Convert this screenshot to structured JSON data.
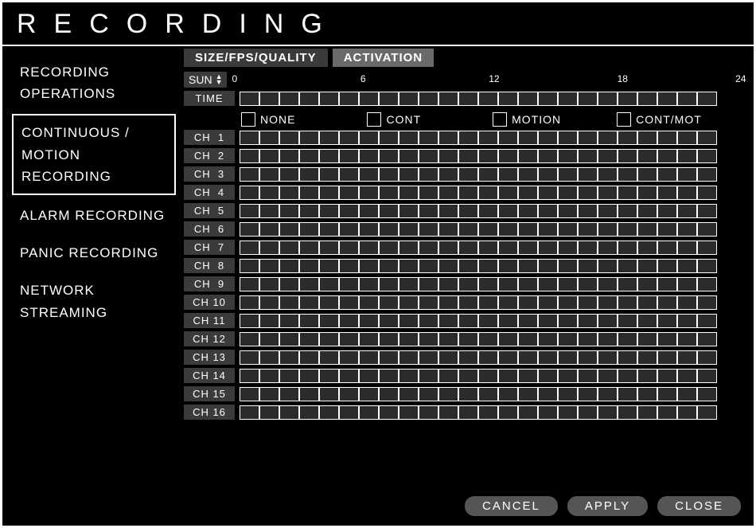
{
  "title": "RECORDING",
  "sidebar": {
    "items": [
      {
        "label": "RECORDING OPERATIONS"
      },
      {
        "label": "CONTINUOUS / MOTION RECORDING"
      },
      {
        "label": "ALARM RECORDING"
      },
      {
        "label": "PANIC RECORDING"
      },
      {
        "label": "NETWORK STREAMING"
      }
    ],
    "selected_index": 1
  },
  "tabs": [
    {
      "label": "SIZE/FPS/QUALITY",
      "active": false
    },
    {
      "label": "ACTIVATION",
      "active": true
    }
  ],
  "day_selector": {
    "value": "SUN"
  },
  "axis_ticks": [
    "0",
    "6",
    "12",
    "18",
    "24"
  ],
  "time_row_label": "TIME",
  "legend": [
    {
      "label": "NONE"
    },
    {
      "label": "CONT"
    },
    {
      "label": "MOTION"
    },
    {
      "label": "CONT/MOT"
    }
  ],
  "channels": [
    {
      "label": "CH  1"
    },
    {
      "label": "CH  2"
    },
    {
      "label": "CH  3"
    },
    {
      "label": "CH  4"
    },
    {
      "label": "CH  5"
    },
    {
      "label": "CH  6"
    },
    {
      "label": "CH  7"
    },
    {
      "label": "CH  8"
    },
    {
      "label": "CH  9"
    },
    {
      "label": "CH 10"
    },
    {
      "label": "CH 11"
    },
    {
      "label": "CH 12"
    },
    {
      "label": "CH 13"
    },
    {
      "label": "CH 14"
    },
    {
      "label": "CH 15"
    },
    {
      "label": "CH 16"
    }
  ],
  "hours_per_row": 24,
  "buttons": {
    "cancel": "CANCEL",
    "apply": "APPLY",
    "close": "CLOSE"
  }
}
